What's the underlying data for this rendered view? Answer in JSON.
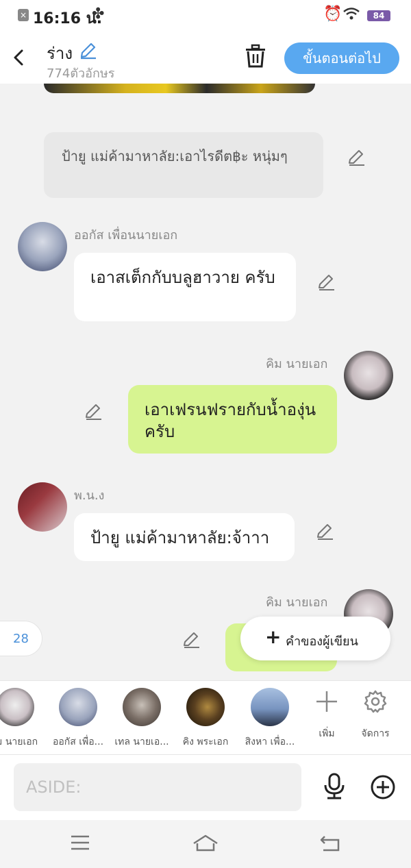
{
  "status": {
    "time": "16:16 น.",
    "battery": "84"
  },
  "header": {
    "title": "ร่าง",
    "char_count": "774ตัวอักษร",
    "next_label": "ขั้นตอนต่อไป"
  },
  "chat": {
    "narration": "ป้ายู แม่ค้ามาหาลัย:เอาไรดีต฿ะ หนุ่มๆ",
    "messages": [
      {
        "name": "ออกัส เพื่อนนายเอก",
        "text": "เอาสเต็กกับบลูฮาวาย ครับ",
        "side": "left"
      },
      {
        "name": "คิม นายเอก",
        "text": "เอาเฟรนฟรายกับน้ำองุ่นครับ",
        "side": "right"
      },
      {
        "name": "พ.น.ง",
        "text": "ป้ายู แม่ค้ามาหาลัย:จ้าาา",
        "side": "left"
      },
      {
        "name": "คิม นายเอก",
        "text": "",
        "side": "right"
      }
    ],
    "badge_count": "28",
    "author_button": "คำของผู้เขียน"
  },
  "characters": [
    {
      "label": "คิม นายเอก",
      "color": "#ddd"
    },
    {
      "label": "ออกัส เพื่อ...",
      "color": "#aab"
    },
    {
      "label": "เทล นายเอ...",
      "color": "#ccc"
    },
    {
      "label": "คิง พระเอก",
      "color": "#5a4020"
    },
    {
      "label": "สิงหา เพื่อ...",
      "color": "#8aa0c0"
    }
  ],
  "tools": {
    "add_label": "เพิ่ม",
    "manage_label": "จัดการ"
  },
  "input": {
    "placeholder": "ASIDE:"
  }
}
